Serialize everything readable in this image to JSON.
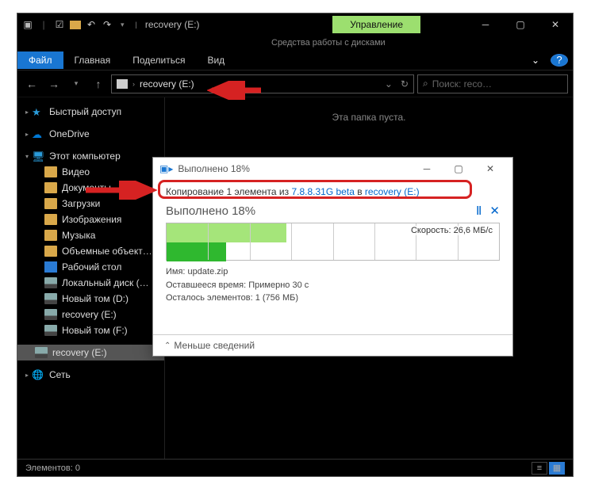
{
  "titlebar": {
    "title": "recovery (E:)"
  },
  "manage": {
    "label": "Управление",
    "sub": "Средства работы с дисками"
  },
  "ribbon": {
    "file": "Файл",
    "tabs": [
      "Главная",
      "Поделиться",
      "Вид"
    ],
    "help": "?",
    "chev": "⌄"
  },
  "addrbar": {
    "path": "recovery (E:)",
    "refresh": "↻",
    "back": "←",
    "forward": "→",
    "up": "↑",
    "search_placeholder": "Поиск: reco…",
    "dropdown": "⌄"
  },
  "content": {
    "empty": "Эта папка пуста."
  },
  "sidebar": {
    "quick": "Быстрый доступ",
    "onedrive": "OneDrive",
    "pc": "Этот компьютер",
    "items": [
      "Видео",
      "Документы",
      "Загрузки",
      "Изображения",
      "Музыка",
      "Объемные объект…",
      "Рабочий стол",
      "Локальный диск (…",
      "Новый том (D:)",
      "recovery (E:)",
      "Новый том (F:)"
    ],
    "selected": "recovery (E:)",
    "network": "Сеть"
  },
  "statusbar": {
    "elements": "Элементов: 0"
  },
  "dialog": {
    "percent": 18,
    "title": "Выполнено 18%",
    "copyline_prefix": "Копирование 1 элемента из ",
    "copyline_src": "7.8.8.31G beta",
    "copyline_mid": " в ",
    "copyline_dst": "recovery (E:)",
    "done": "Выполнено 18%",
    "pause": "Ⅱ",
    "cancel": "✕",
    "speed": "Скорость: 26,6 МБ/с",
    "details": {
      "name_label": "Имя:",
      "name": "update.zip",
      "remain_label": "Оставшееся время:",
      "remain": "Примерно 30 с",
      "items_label": "Осталось элементов:",
      "items": "1 (756 МБ)"
    },
    "fewer": "Меньше сведений"
  }
}
